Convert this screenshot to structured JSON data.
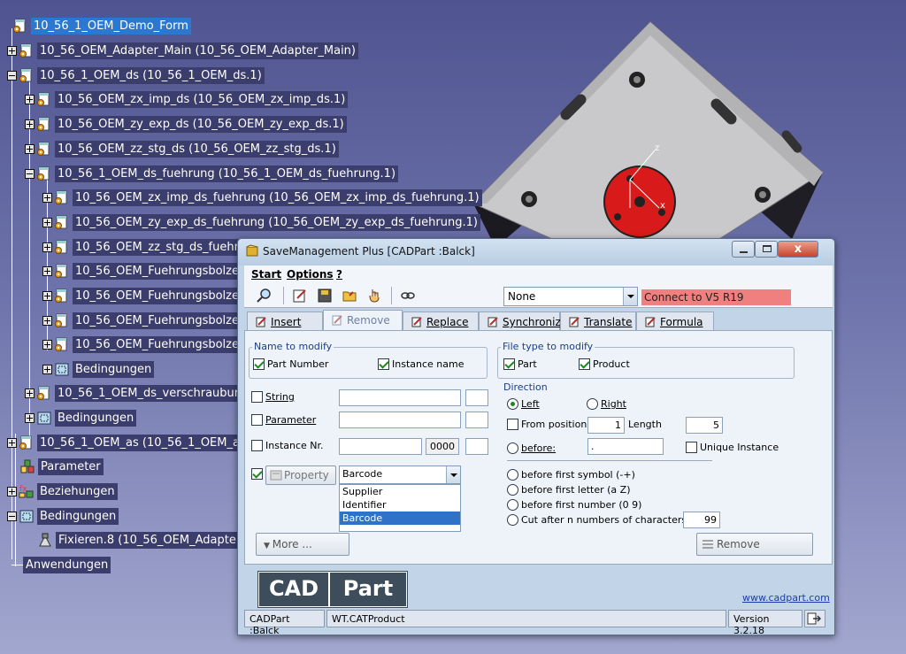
{
  "tree": {
    "nodes": [
      {
        "label": "10_56_1_OEM_Demo_Form",
        "selected": true
      },
      {
        "label": "10_56_OEM_Adapter_Main (10_56_OEM_Adapter_Main)"
      },
      {
        "label": "10_56_1_OEM_ds (10_56_1_OEM_ds.1)"
      },
      {
        "label": "10_56_OEM_zx_imp_ds (10_56_OEM_zx_imp_ds.1)"
      },
      {
        "label": "10_56_OEM_zy_exp_ds (10_56_OEM_zy_exp_ds.1)"
      },
      {
        "label": "10_56_OEM_zz_stg_ds (10_56_OEM_zz_stg_ds.1)"
      },
      {
        "label": "10_56_1_OEM_ds_fuehrung (10_56_1_OEM_ds_fuehrung.1)"
      },
      {
        "label": "10_56_OEM_zx_imp_ds_fuehrung (10_56_OEM_zx_imp_ds_fuehrung.1)"
      },
      {
        "label": "10_56_OEM_zy_exp_ds_fuehrung (10_56_OEM_zy_exp_ds_fuehrung.1)"
      },
      {
        "label": "10_56_OEM_zz_stg_ds_fuehr"
      },
      {
        "label": "10_56_OEM_Fuehrungsbolze"
      },
      {
        "label": "10_56_OEM_Fuehrungsbolze"
      },
      {
        "label": "10_56_OEM_Fuehrungsbolze"
      },
      {
        "label": "10_56_OEM_Fuehrungsbolze"
      },
      {
        "label": "Bedingungen"
      },
      {
        "label": "10_56_1_OEM_ds_verschraubur"
      },
      {
        "label": "Bedingungen"
      },
      {
        "label": "10_56_1_OEM_as (10_56_1_OEM_a:"
      },
      {
        "label": "Parameter"
      },
      {
        "label": "Beziehungen"
      },
      {
        "label": "Bedingungen"
      },
      {
        "label": "Fixieren.8 (10_56_OEM_Adapte"
      },
      {
        "label": "Anwendungen"
      }
    ]
  },
  "dialog": {
    "title": "SaveManagement Plus [CADPart :Balck]",
    "close": "x",
    "menu": [
      "Start",
      "Options",
      "?"
    ],
    "version_combo": "None",
    "connect_label": "Connect to V5 R19",
    "tabs": [
      "Insert",
      "Remove",
      "Replace",
      "Synchronize",
      "Translate",
      "Formula"
    ],
    "name_group": {
      "label": "Name to modify",
      "part_number": "Part Number",
      "instance_name": "Instance name"
    },
    "filetype_group": {
      "label": "File type to modify",
      "part": "Part",
      "product": "Product"
    },
    "string_label": "String",
    "parameter_label": "Parameter",
    "instance_nr_label": "Instance Nr.",
    "instance_nr_value": "0000",
    "property_label": "Property",
    "property_combo": "Barcode",
    "property_options": [
      "Supplier",
      "Identifier",
      "Barcode"
    ],
    "direction": {
      "label": "Direction",
      "left": "Left",
      "right": "Right"
    },
    "from_position": "From position",
    "from_position_value": "1",
    "length_label": "Length",
    "length_value": "5",
    "before_label": "before:",
    "before_value": ".",
    "unique_instance": "Unique Instance",
    "before_symbol": "before first symbol (-+)",
    "before_letter": "before first letter (a Z)",
    "before_number": "before first number (0 9)",
    "cut_after": "Cut after n numbers of characters",
    "cut_value": "99",
    "more_button": "More ...",
    "remove_button": "Remove",
    "logo_left": "CAD",
    "logo_right": "Part",
    "website": "www.cadpart.com",
    "status_user": "CADPart :Balck",
    "status_file": "WT.CATProduct",
    "status_version": "Version 3.2.18"
  },
  "colors": {
    "desktop": "#5b60a0",
    "tree_label_bg": "#3b3d6c",
    "selected": "#2a78d0",
    "connect": "#f08080",
    "panel": "#eef3f9",
    "part_red": "#e02020"
  }
}
